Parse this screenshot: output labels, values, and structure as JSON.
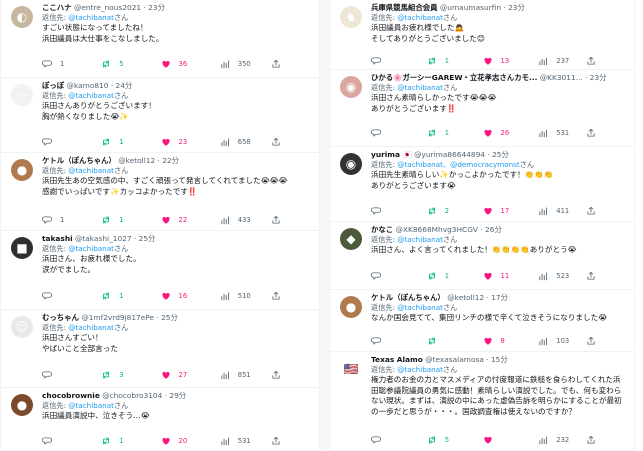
{
  "left_tweets": [
    {
      "avatar_icon": "avatar-icon",
      "avatar_color": "#c7b79e",
      "avatar_glyph": "◐",
      "name": "ここハナ",
      "handle": "@entre_nous2021",
      "time": "· 23分",
      "reply_prefix": "返信先: ",
      "reply_handle": "@tachibanat",
      "reply_suffix": "さん",
      "text": "すごい状態になってましたね！\n浜田議員は大仕事をこなしました。",
      "replies": "1",
      "retweets": "5",
      "likes": "36",
      "views": "350"
    },
    {
      "avatar_icon": "avatar-icon",
      "avatar_color": "#f2f2f2",
      "avatar_glyph": "〜",
      "name": "ぽっぽ",
      "handle": "@kamo810",
      "time": "· 24分",
      "reply_prefix": "返信先: ",
      "reply_handle": "@tachibanat",
      "reply_suffix": "さん",
      "text": "浜田さんありがとうございます！\n胸が熱くなりました😭✨",
      "replies": "",
      "retweets": "1",
      "likes": "23",
      "views": "658"
    },
    {
      "avatar_icon": "avatar-icon",
      "avatar_color": "#b07a4f",
      "avatar_glyph": "●",
      "name": "ケトル（ぽんちゃん）",
      "handle": "@ketoll12",
      "time": "· 22分",
      "reply_prefix": "返信先: ",
      "reply_handle": "@tachibanat",
      "reply_suffix": "さん",
      "text": "浜田先生あの空気感の中、すごく頑張って発言してくれてました😭😭😭\n感謝でいっぱいです✨カッコよかったです‼️",
      "replies": "1",
      "retweets": "1",
      "likes": "22",
      "views": "433"
    },
    {
      "avatar_icon": "avatar-icon",
      "avatar_color": "#2f2f2f",
      "avatar_glyph": "■",
      "name": "takashi",
      "handle": "@takashi_1027",
      "time": "· 25分",
      "reply_prefix": "返信先: ",
      "reply_handle": "@tachibanat",
      "reply_suffix": "さん",
      "text": "浜田さん、お疲れ様でした。\n涙がでました。",
      "replies": "",
      "retweets": "1",
      "likes": "16",
      "views": "510"
    },
    {
      "avatar_icon": "avatar-icon",
      "avatar_color": "#e9e9e9",
      "avatar_glyph": "☺",
      "name": "むっちゃん",
      "handle": "@1mf2vrd9j817ePe",
      "time": "· 25分",
      "reply_prefix": "返信先: ",
      "reply_handle": "@tachibanat",
      "reply_suffix": "さん",
      "text": "浜田さんすごい！\nやばいこと全部言った",
      "replies": "",
      "retweets": "3",
      "likes": "27",
      "views": "851"
    },
    {
      "avatar_icon": "avatar-icon",
      "avatar_color": "#7a4a2a",
      "avatar_glyph": "●",
      "name": "chocobrownie",
      "handle": "@chocobro3104",
      "time": "· 29分",
      "reply_prefix": "返信先: ",
      "reply_handle": "@tachibanat",
      "reply_suffix": "さん",
      "text": "浜田議員演説中、泣きそう…😭",
      "replies": "",
      "retweets": "1",
      "likes": "20",
      "views": "531"
    }
  ],
  "right_tweets": [
    {
      "avatar_icon": "avatar-icon",
      "avatar_color": "#efe6d6",
      "avatar_glyph": "♞",
      "name": "兵庫県競馬組合会員",
      "handle": "@umaumasurfin",
      "time": "· 23分",
      "reply_prefix": "返信先: ",
      "reply_handle": "@tachibanat",
      "reply_suffix": "さん",
      "text": "浜田議員お疲れ様でした🙇\nそしてありがとうございました😊",
      "replies": "",
      "retweets": "1",
      "likes": "13",
      "views": "237"
    },
    {
      "avatar_icon": "avatar-icon",
      "avatar_color": "#d9a6a0",
      "avatar_glyph": "◉",
      "name": "ひかる🌸ガーシーGAREW・立花孝志さんカモ...",
      "handle": "@KK3011...",
      "time": "· 23分",
      "reply_prefix": "返信先: ",
      "reply_handle": "@tachibanat",
      "reply_suffix": "さん",
      "text": "浜田さん素晴らしかったです😭😭😭\nありがとうございます‼️",
      "replies": "",
      "retweets": "1",
      "likes": "26",
      "views": "531"
    },
    {
      "avatar_icon": "avatar-icon",
      "avatar_color": "#333333",
      "avatar_glyph": "◉",
      "name": "yurima 🇯🇵",
      "handle": "@yurima86644894",
      "time": "· 25分",
      "reply_prefix": "返信先: ",
      "reply_handle": "@tachibanat、@democracymonst",
      "reply_suffix": "さん",
      "text": "浜田先生素晴らしい✨かっこよかったです！👏👏👏\nありがとうございます😭",
      "replies": "",
      "retweets": "2",
      "likes": "17",
      "views": "411"
    },
    {
      "avatar_icon": "avatar-icon",
      "avatar_color": "#4a5a3a",
      "avatar_glyph": "◆",
      "name": "かなこ",
      "handle": "@XK8668Mhvg3HCGV",
      "time": "· 26分",
      "reply_prefix": "返信先: ",
      "reply_handle": "@tachibanat",
      "reply_suffix": "さん",
      "text": "浜田さん、よく言ってくれました！👏👏👏👏ありがとう😭",
      "replies": "",
      "retweets": "1",
      "likes": "11",
      "views": "523"
    },
    {
      "avatar_icon": "avatar-icon",
      "avatar_color": "#b07a4f",
      "avatar_glyph": "●",
      "name": "ケトル（ぽんちゃん）",
      "handle": "@ketoll12",
      "time": "· 17分",
      "reply_prefix": "返信先: ",
      "reply_handle": "@tachibanat",
      "reply_suffix": "さん",
      "text": "なんか国会見てて、集団リンチの様で辛くて泣きそうになりました😭",
      "replies": "",
      "retweets": "",
      "likes": "8",
      "views": "103"
    },
    {
      "avatar_icon": "flag-icon",
      "avatar_color": "#ffffff",
      "avatar_glyph": "🇺🇸",
      "name": "Texas Alamo",
      "handle": "@texasalamosa",
      "time": "· 15分",
      "reply_prefix": "返信先: ",
      "reply_handle": "@tachibanat",
      "reply_suffix": "さん",
      "text": "権力者のお金の力とマスメディアの忖度報道に鉄槌を食らわしてくれた浜田聡参議院議員の勇気に感動！素晴らしい演説でした。でも、何も変わらない現状。まずは、演説の中にあった虚偽告訴を明らかにすることが最初の一歩だと思うが・・・。国政調査権は使えないのですか？",
      "replies": "",
      "retweets": "5",
      "likes": "",
      "views": "232"
    }
  ]
}
